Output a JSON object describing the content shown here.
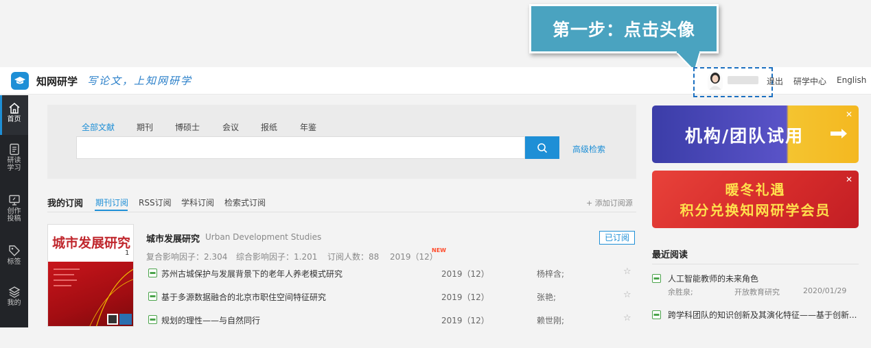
{
  "callout": {
    "text": "第一步：点击头像"
  },
  "header": {
    "logo_text": "知网研学",
    "slogan": "写论文，上知网研学",
    "logout": "退出",
    "research_center": "研学中心",
    "english": "English"
  },
  "leftnav": {
    "items": [
      {
        "label_line1": "首页",
        "label_line2": "",
        "icon": "home-icon"
      },
      {
        "label_line1": "研读",
        "label_line2": "学习",
        "icon": "document-icon"
      },
      {
        "label_line1": "创作",
        "label_line2": "投稿",
        "icon": "monitor-icon"
      },
      {
        "label_line1": "标签",
        "label_line2": "",
        "icon": "tag-icon"
      },
      {
        "label_line1": "我的",
        "label_line2": "",
        "icon": "layers-icon"
      }
    ]
  },
  "search": {
    "tabs": [
      "全部文献",
      "期刊",
      "博硕士",
      "会议",
      "报纸",
      "年鉴"
    ],
    "input_value": "",
    "advanced": "高级检索"
  },
  "subscription": {
    "title": "我的订阅",
    "tabs": [
      "期刊订阅",
      "RSS订阅",
      "学科订阅",
      "检索式订阅"
    ],
    "add": "+ 添加订阅源",
    "journal": {
      "cover_title": "城市发展研究",
      "cover_num": "1",
      "name": "城市发展研究",
      "name_en": "Urban Development Studies",
      "impact1": "复合影响因子：2.304",
      "impact2": "综合影响因子：1.201",
      "subscribers": "订阅人数：88",
      "issue": "2019（12）",
      "new_badge": "NEW",
      "subscribed": "已订阅"
    },
    "articles": [
      {
        "title": "苏州古城保护与发展背景下的老年人养老模式研究",
        "year": "2019（12）",
        "author": "杨梓含;"
      },
      {
        "title": "基于多源数据融合的北京市职住空间特征研究",
        "year": "2019（12）",
        "author": "张艳;"
      },
      {
        "title": "规划的理性——与自然同行",
        "year": "2019（12）",
        "author": "赖世刚;"
      }
    ]
  },
  "banners": {
    "b1": "机构/团队试用",
    "b2_line1": "暖冬礼遇",
    "b2_line2": "积分兑换知网研学会员"
  },
  "recent": {
    "title": "最近阅读",
    "items": [
      {
        "title": "人工智能教师的未来角色",
        "author": "余胜泉;",
        "source": "开放教育研究",
        "date": "2020/01/29"
      },
      {
        "title": "跨学科团队的知识创新及其演化特征——基于创新...",
        "author": "",
        "source": "",
        "date": ""
      }
    ]
  },
  "colors": {
    "accent": "#1e8fd6",
    "callout": "#4aa3c0",
    "nav_bg": "#222428"
  }
}
